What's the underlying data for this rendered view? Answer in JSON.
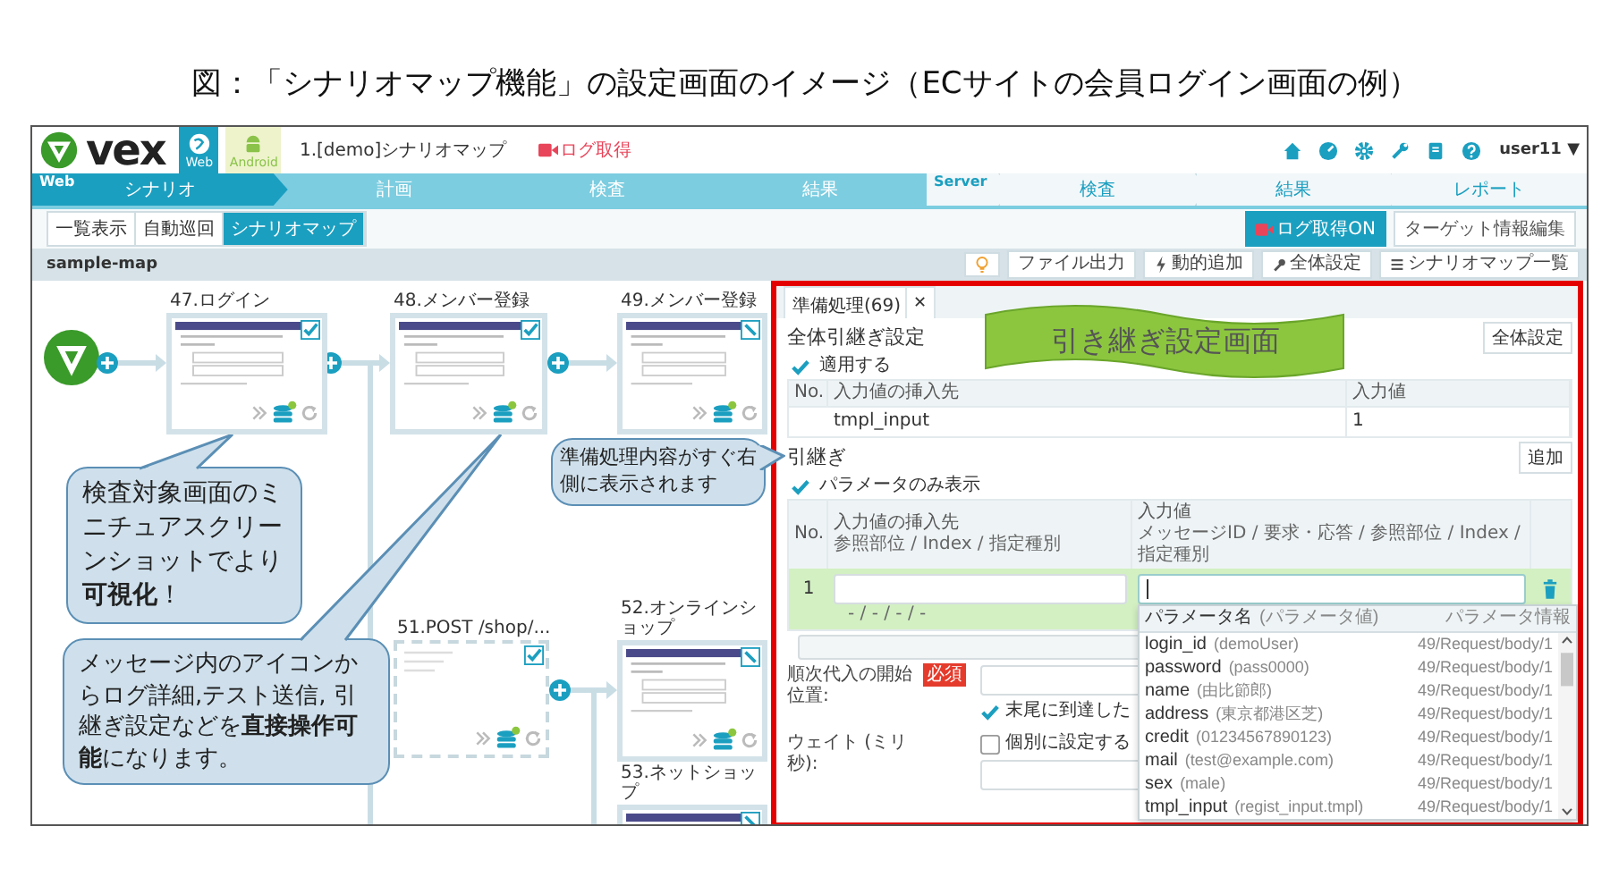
{
  "caption": "図：「シナリオマップ機能」の設定画面のイメージ（ECサイトの会員ログイン画面の例）",
  "app": {
    "logo": "vex",
    "platforms": [
      {
        "label": "Web",
        "selected": true
      },
      {
        "label": "Android",
        "selected": false
      }
    ],
    "project": "1.[demo]シナリオマップ",
    "log_status": "ログ取得",
    "user": "user11",
    "user_caret": "▼"
  },
  "nav": [
    {
      "label": "Web",
      "active": true,
      "steps": [
        {
          "label": "シナリオ",
          "selected": true
        },
        {
          "label": "計画",
          "selected": false
        },
        {
          "label": "検査",
          "selected": false
        },
        {
          "label": "結果",
          "selected": false
        }
      ]
    },
    {
      "label": "Server",
      "active": false,
      "steps": [
        {
          "label": "検査",
          "selected": false
        },
        {
          "label": "結果",
          "selected": false
        },
        {
          "label": "レポート",
          "selected": false
        }
      ]
    }
  ],
  "view_tabs": [
    {
      "label": "一覧表示",
      "selected": false
    },
    {
      "label": "自動巡回",
      "selected": false
    },
    {
      "label": "シナリオマップ",
      "selected": true
    }
  ],
  "actions": [
    {
      "label": "ログ取得ON",
      "kind": "record"
    },
    {
      "label": "ターゲット情報編集",
      "kind": "plain"
    }
  ],
  "map": {
    "title": "sample-map",
    "toolbar": [
      {
        "kind": "hint"
      },
      {
        "label": "ファイル出力",
        "kind": "plain"
      },
      {
        "label": "動的追加",
        "kind": "bolt"
      },
      {
        "label": "全体設定",
        "kind": "settings"
      },
      {
        "label": "シナリオマップ一覧",
        "kind": "list"
      }
    ],
    "nodes": [
      {
        "title": "47.ログイン",
        "kind": "screen",
        "checked": true
      },
      {
        "title": "48.メンバー登録",
        "kind": "screen",
        "checked": true
      },
      {
        "title": "49.メンバー登録",
        "kind": "screen",
        "checked": false
      },
      {
        "title": "51.POST /shop/...",
        "kind": "request",
        "checked": true
      },
      {
        "title": "52.オンラインショップ",
        "kind": "screen",
        "checked": false
      },
      {
        "title": "53.ネットショップ",
        "kind": "screen",
        "checked": false
      }
    ],
    "callouts": [
      "検査対象画面のミニチュアスクリーンショットでより**可視化**！",
      "メッセージ内のアイコンからログ詳細,テスト送信, 引継ぎ設定などを**直接操作可能**になります。",
      "準備処理内容がすぐ右側に表示されます"
    ]
  },
  "panel": {
    "tab": {
      "label": "準備処理(69)",
      "close": "✕"
    },
    "banner": "引き継ぎ設定画面",
    "global": {
      "title": "全体引継ぎ設定",
      "button": "全体設定",
      "apply": {
        "label": "適用する",
        "checked": true
      },
      "columns": [
        "No.",
        "入力値の挿入先",
        "入力値"
      ],
      "rows": [
        {
          "target": "tmpl_input",
          "value": "1"
        }
      ]
    },
    "handover": {
      "title": "引継ぎ",
      "button": "追加",
      "params_only": {
        "label": "パラメータのみ表示",
        "checked": true
      },
      "columns": [
        {
          "label": "No."
        },
        {
          "label": "入力値の挿入先",
          "sub": "参照部位 / Index / 指定種別"
        },
        {
          "label": "入力値",
          "sub": "メッセージID / 要求・応答 / 参照部位 / Index / 指定種別"
        }
      ],
      "rows": [
        {
          "no": "1",
          "selected": true,
          "hint": "- / - / - / -"
        }
      ]
    },
    "dropdown": {
      "header": {
        "name": "パラメータ名",
        "value": "(パラメータ値)",
        "info": "パラメータ情報"
      },
      "items": [
        {
          "name": "login_id",
          "value": "(demoUser)",
          "info": "49/Request/body/1"
        },
        {
          "name": "password",
          "value": "(pass0000)",
          "info": "49/Request/body/1"
        },
        {
          "name": "name",
          "value": "(由比節郎)",
          "info": "49/Request/body/1"
        },
        {
          "name": "address",
          "value": "(東京都港区芝)",
          "info": "49/Request/body/1"
        },
        {
          "name": "credit",
          "value": "(01234567890123)",
          "info": "49/Request/body/1"
        },
        {
          "name": "mail",
          "value": "(test@example.com)",
          "info": "49/Request/body/1"
        },
        {
          "name": "sex",
          "value": "(male)",
          "info": "49/Request/body/1"
        },
        {
          "name": "tmpl_input",
          "value": "(regist_input.tmpl)",
          "info": "49/Request/body/1"
        }
      ]
    },
    "form": [
      {
        "label": "順次代入の開始位置:",
        "kind": "input_first",
        "required": "必須",
        "option": {
          "label": "末尾に到達した",
          "checked": true
        }
      },
      {
        "label": "ウェイト (ミリ秒):",
        "kind": "option_first",
        "option": {
          "label": "個別に設定する",
          "checked": false
        }
      }
    ]
  }
}
